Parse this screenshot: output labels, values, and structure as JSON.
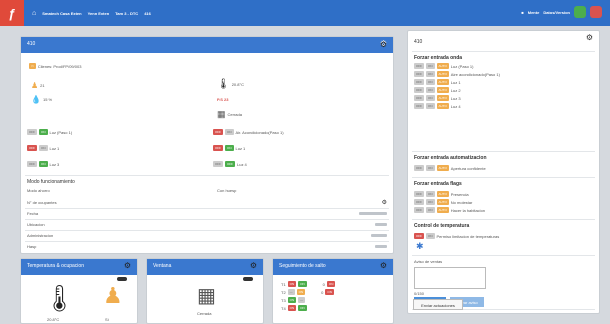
{
  "topbar": {
    "logo_glyph": "ƒ",
    "home_icon": "home-icon",
    "breadcrumb": [
      "Smatech Casa Exten",
      "Yenn Exten",
      "Tam 3 - DTC",
      "416"
    ],
    "right": [
      "Mente",
      "Datos/Version"
    ],
    "colors": {
      "bar": "#2f6fc7",
      "logo": "#e04a3a",
      "green": "#4cae4c",
      "red": "#d9534f"
    }
  },
  "main": {
    "title": "410",
    "device_line": "Clienes: Prod/FP/09/003",
    "temp_small": "21",
    "temp_right": "20.8°C",
    "humidity": "15 %",
    "ps_value": "P.S 23",
    "window_label": "Cerrada",
    "left_flags": [
      {
        "tag": "ON",
        "label": "Luz (Paso 1)"
      },
      {
        "tag": "ON",
        "label": "Luz 1"
      },
      {
        "tag": "ON",
        "label": "Luz 3"
      }
    ],
    "right_flags": [
      {
        "tag": "OFF",
        "label": "Air. Acondicionado(Paso 1)"
      },
      {
        "tag": "OFF",
        "label": "Luz 1"
      },
      {
        "tag": "OFF",
        "label": "Luz 4"
      }
    ],
    "mode_title": "Modo funcionamiento",
    "mode_col1": "Modo ahorro",
    "mode_col2": "Con huesp",
    "list_rows": [
      {
        "label": "N° de ocupantes"
      },
      {
        "label": "Fecha"
      },
      {
        "label": "Ubicacion"
      },
      {
        "label": "Administracion"
      },
      {
        "label": "Hasp"
      }
    ]
  },
  "side": {
    "title": "410",
    "sections": [
      {
        "title": "Forzar entrada onda",
        "items": [
          "Luz (Paso 1)",
          "Aire acondicionado(Paso 1)",
          "Luz 1",
          "Luz 2",
          "Luz 3",
          "Luz 4"
        ]
      },
      {
        "title": "Forzar entrada automatizacion",
        "items": [
          "Apertura confidente"
        ]
      },
      {
        "title": "Forzar entrada flags",
        "items": [
          "Presencia",
          "No molestar",
          "Hacer la habitacion"
        ]
      }
    ],
    "temp_control_title": "Control de temperatura",
    "temp_control_item": "Permiso limitacion de temperaturas",
    "notes_title": "Aviso de ventas",
    "notes_count": "0/150",
    "send_btn": "Enviar aviso",
    "clear_btn": "Borrar aviso",
    "apply_btn": "Enviar actuaciones"
  },
  "bottom": [
    {
      "title": "Temperatura & ocupacion",
      "temp": "20.8°C",
      "people": "Sí"
    },
    {
      "title": "Ventana",
      "state": "Cerrada"
    },
    {
      "title": "Seguimiento de salto",
      "rows": [
        "T1",
        "T2",
        "T3",
        "T4"
      ]
    }
  ]
}
